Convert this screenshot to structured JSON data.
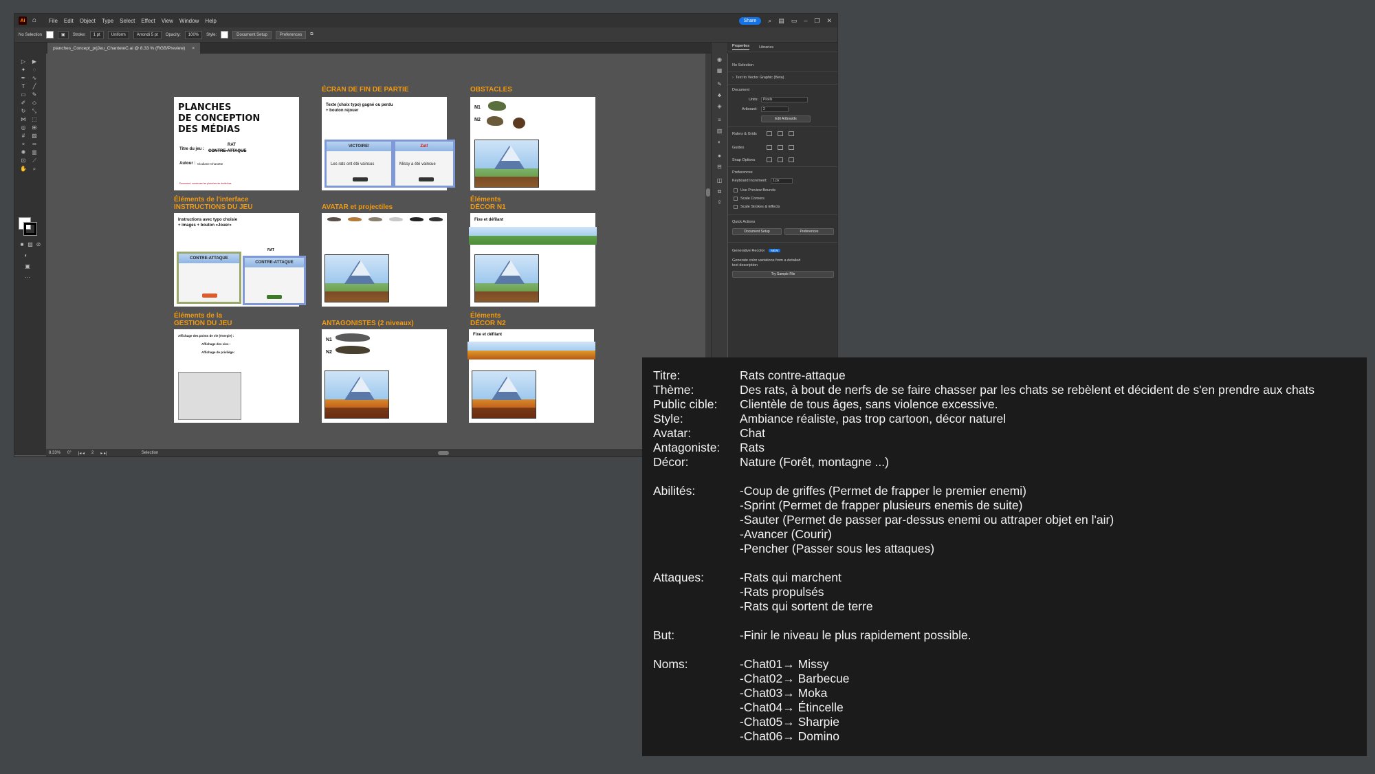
{
  "app": {
    "logo": "Ai",
    "menus": [
      "File",
      "Edit",
      "Object",
      "Type",
      "Select",
      "Effect",
      "View",
      "Window",
      "Help"
    ],
    "share_label": "Share"
  },
  "controlbar": {
    "selection": "No Selection",
    "stroke_label": "Stroke:",
    "stroke_value": "1 pt",
    "uniform": "Uniform",
    "brush": "Arrondi 5 pt",
    "opacity_label": "Opacity:",
    "opacity_value": "100%",
    "style_label": "Style:",
    "doc_setup": "Document Setup",
    "preferences": "Preferences"
  },
  "document_tab": {
    "title": "planches_Concept_prjJeu_ChanteteC.ai @ 8.33 % (RGB/Preview)",
    "close": "×"
  },
  "statusbar": {
    "zoom": "8.33%",
    "rotation": "0°",
    "artboard": "2",
    "tool": "Selection"
  },
  "properties": {
    "tab_properties": "Properties",
    "tab_libraries": "Libraries",
    "no_selection": "No Selection",
    "text_to_vector": "Text to Vector Graphic (Beta)",
    "document_label": "Document",
    "units_label": "Units:",
    "units_value": "Pixels",
    "artboard_label": "Artboard:",
    "artboard_value": "2",
    "edit_artboards": "Edit Artboards",
    "rulers_grids": "Rulers & Grids",
    "guides": "Guides",
    "snap_options": "Snap Options",
    "preferences_label": "Preferences",
    "keyboard_increment_label": "Keyboard Increment:",
    "keyboard_increment_value": "1 px",
    "use_preview_bounds": "Use Preview Bounds",
    "scale_corners": "Scale Corners",
    "scale_strokes": "Scale Strokes & Effects",
    "quick_actions": "Quick Actions",
    "qa_doc_setup": "Document Setup",
    "qa_preferences": "Preferences",
    "generative_recolor": "Generative Recolor",
    "new_badge": "NEW",
    "gen_desc_1": "Generate color variations from a detailed",
    "gen_desc_2": "text description",
    "try_sample": "Try Sample File"
  },
  "artboards": {
    "ab1": {
      "title_line1": "PLANCHES",
      "title_line2": "DE CONCEPTION",
      "title_line3": "DES MÉDIAS",
      "game_title_label": "Titre du jeu :",
      "game_title_top": "RAT",
      "game_title_bottom": "CONTRE-ATTAQUE",
      "author_label": "Autour :",
      "author_value": "Clodiane Chanette",
      "footer": "Document: numéroter les planches de droite/bas"
    },
    "ab2": {
      "heading": "ÉCRAN DE FIN DE PARTIE",
      "text_line1": "Texte (choix typo) gagné ou perdu",
      "text_line2": "+ bouton rejouer",
      "win_title": "VICTOIRE!",
      "win_text": "Les rats ont été vaincus",
      "lose_title": "Zut!",
      "lose_text": "Missy a été vaincue"
    },
    "ab3": {
      "heading": "OBSTACLES",
      "n1": "N1",
      "n2": "N2"
    },
    "ab4": {
      "heading_line1": "Éléments de l'interface",
      "heading_line2": "INSTRUCTIONS DU JEU",
      "text_line1": "Instructions avec typo choisie",
      "text_line2": "+ images + bouton «Jouer»",
      "panel_title1": "RAT",
      "panel_title2": "CONTRE-ATTAQUE"
    },
    "ab5": {
      "heading": "AVATAR et projectiles"
    },
    "ab6": {
      "heading_line1": "Éléments",
      "heading_line2": "DÉCOR N1",
      "text": "Fixe et défilant"
    },
    "ab7": {
      "heading_line1": "Éléments de la",
      "heading_line2": "GESTION DU JEU",
      "line1": "Affichage des points de vie (énergie) :",
      "line2": "Affichage des vies :",
      "line3": "Affichage de privilège :"
    },
    "ab8": {
      "heading": "ANTAGONISTES (2 niveaux)",
      "n1": "N1",
      "n2": "N2"
    },
    "ab9": {
      "heading_line1": "Éléments",
      "heading_line2": "DÉCOR N2",
      "text": "Fixe et défilant"
    }
  },
  "note": {
    "rows": [
      {
        "label": "Titre:",
        "value": "Rats contre-attaque"
      },
      {
        "label": "Thème:",
        "value": "Des rats, à bout de nerfs de se faire chasser par les chats se rebèlent et décident de s'en prendre aux chats"
      },
      {
        "label": "Public cible:",
        "value": " Clientèle de tous âges, sans violence excessive."
      },
      {
        "label": "Style:",
        "value": "Ambiance réaliste, pas trop cartoon, décor naturel"
      },
      {
        "label": "Avatar:",
        "value": "Chat"
      },
      {
        "label": "Antagoniste:",
        "value": " Rats"
      },
      {
        "label": "Décor:",
        "value": " Nature (Forêt, montagne ...)"
      }
    ],
    "abilities_label": "Abilités:",
    "abilities": [
      " -Coup de griffes (Permet de frapper le premier enemi)",
      " -Sprint (Permet de frapper plusieurs enemis de suite)",
      " -Sauter (Permet de passer par-dessus enemi ou attraper objet en l'air)",
      " -Avancer (Courir)",
      " -Pencher (Passer sous les attaques)"
    ],
    "attacks_label": "Attaques:",
    "attacks": [
      " -Rats qui marchent",
      " -Rats propulsés",
      " -Rats qui sortent de terre"
    ],
    "goal_label": "But:",
    "goal": "-Finir le niveau le plus rapidement possible.",
    "names_label": "Noms:",
    "names": [
      "-Chat01→ Missy",
      "-Chat02→ Barbecue",
      "-Chat03→ Moka",
      "-Chat04→ Étincelle",
      "-Chat05→ Sharpie",
      "-Chat06→ Domino"
    ]
  }
}
